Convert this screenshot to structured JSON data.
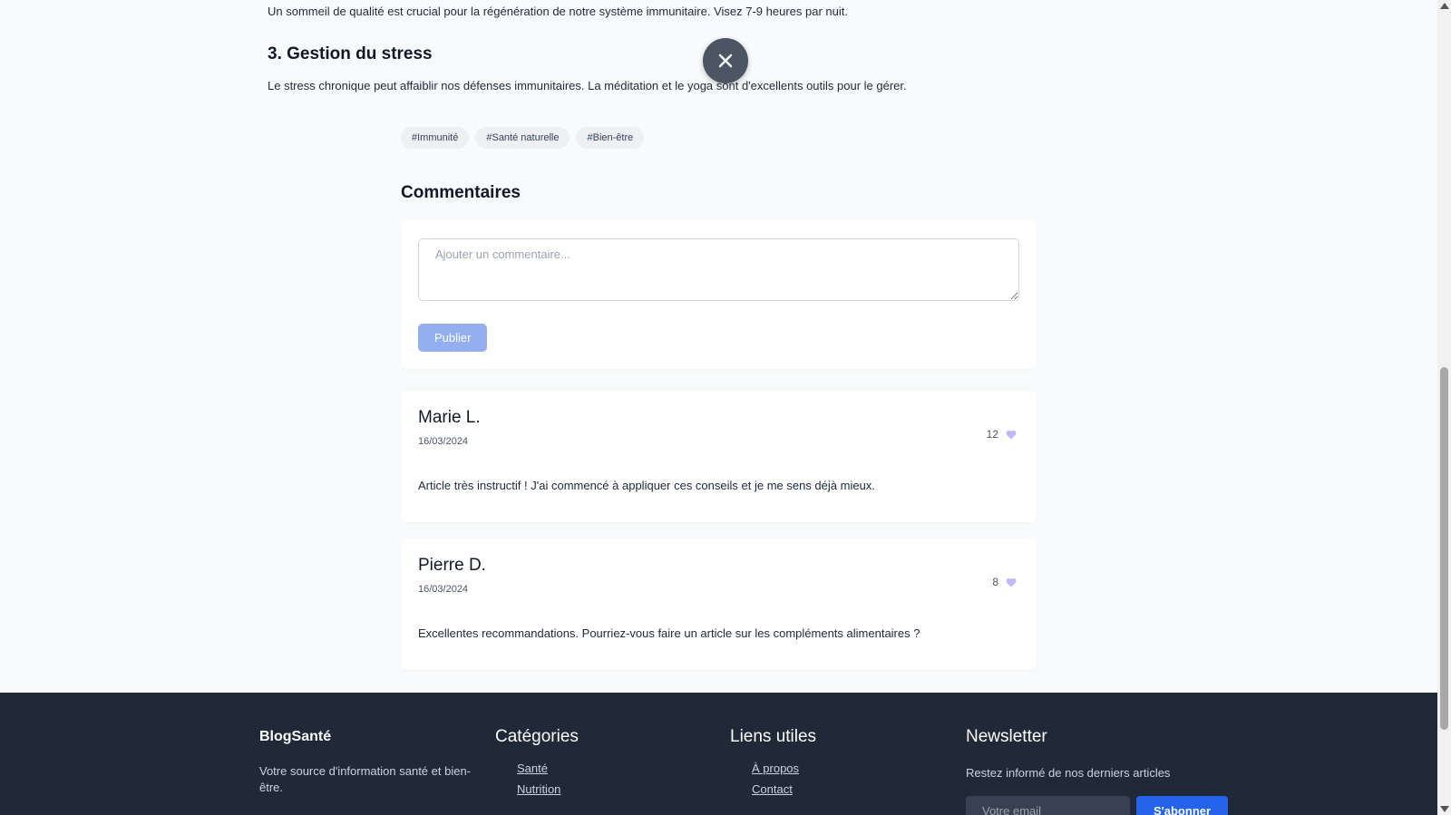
{
  "article": {
    "paragraph_sleep": "Un sommeil de qualité est crucial pour la régénération de notre système immunitaire. Visez 7-9 heures par nuit.",
    "stress_heading": "3. Gestion du stress",
    "paragraph_stress": "Le stress chronique peut affaiblir nos défenses immunitaires. La méditation et le yoga sont d'excellents outils pour le gérer.",
    "tags": [
      "#Immunité",
      "#Santé naturelle",
      "#Bien-être"
    ]
  },
  "close_icon": "close-icon",
  "comments": {
    "title": "Commentaires",
    "placeholder": "Ajouter un commentaire...",
    "publish_label": "Publier",
    "items": [
      {
        "author": "Marie L.",
        "date": "16/03/2024",
        "likes": "12",
        "text": "Article très instructif ! J'ai commencé à appliquer ces conseils et je me sens déjà mieux."
      },
      {
        "author": "Pierre D.",
        "date": "16/03/2024",
        "likes": "8",
        "text": "Excellentes recommandations. Pourriez-vous faire un article sur les compléments alimentaires ?"
      }
    ]
  },
  "footer": {
    "brand": "BlogSanté",
    "description": "Votre source d'information santé et bien-être.",
    "categories": {
      "title": "Catégories",
      "links": [
        "Santé",
        "Nutrition"
      ]
    },
    "useful_links": {
      "title": "Liens utiles",
      "links": [
        "À propos",
        "Contact"
      ]
    },
    "newsletter": {
      "title": "Newsletter",
      "text": "Restez informé de nos derniers articles",
      "email_placeholder": "Votre email",
      "subscribe_label": "S'abonner"
    }
  },
  "colors": {
    "primary": "#2563eb",
    "publish_disabled": "#93aff0",
    "footer_bg": "#1f2937",
    "heart": "#c4b5fd"
  }
}
